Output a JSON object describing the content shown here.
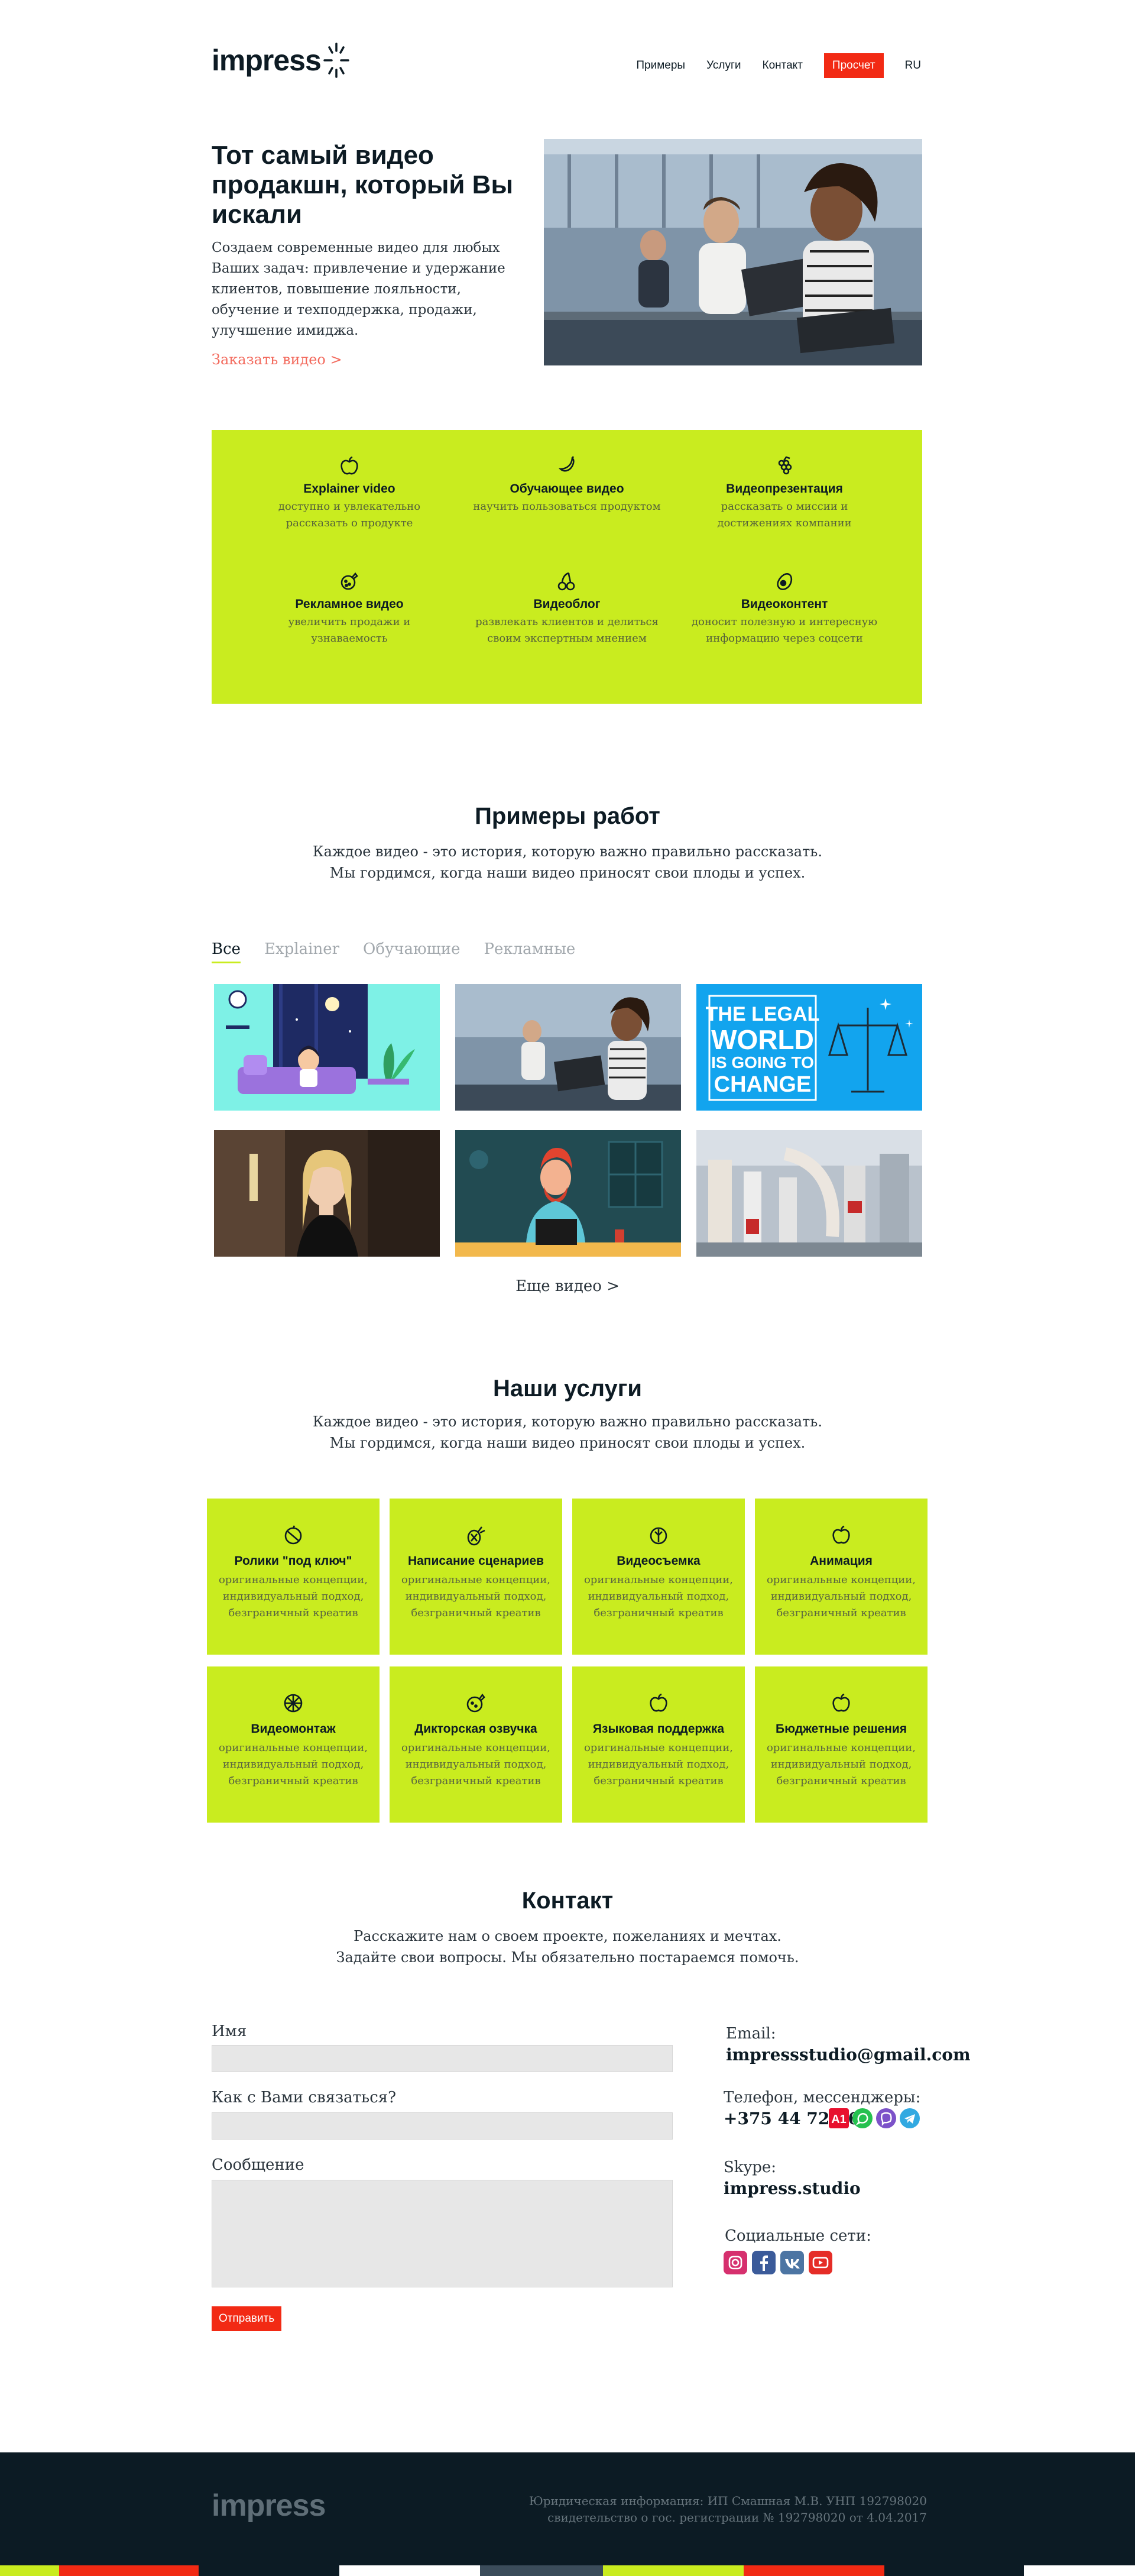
{
  "header": {
    "logo": "impress",
    "nav": [
      "Примеры",
      "Услуги",
      "Контакт"
    ],
    "cta": "Просчет",
    "lang": "RU"
  },
  "hero": {
    "title": "Тот самый видео продакшн, который Вы искали",
    "text": "Создаем современные видео для любых Ваших задач: привлечение и удержание клиентов, повышение лояльности, обучение и техподдержка, продажи, улучшение имиджа.",
    "link": "Заказать видео >"
  },
  "features": [
    {
      "icon": "apple-icon",
      "title": "Explainer video",
      "text": "доступно и увлекательно рассказать о продукте"
    },
    {
      "icon": "banana-icon",
      "title": "Обучающее видео",
      "text": "научить пользоваться продуктом"
    },
    {
      "icon": "grapes-icon",
      "title": "Видеопрезентация",
      "text": "рассказать о миссии и достижениях компании"
    },
    {
      "icon": "pomegranate-icon",
      "title": "Рекламное видео",
      "text": "увеличить продажи и узнаваемость"
    },
    {
      "icon": "cherries-icon",
      "title": "Видеоблог",
      "text": "развлекать клиентов и делиться своим экспертным мнением"
    },
    {
      "icon": "avocado-icon",
      "title": "Видеоконтент",
      "text": "доносит полезную и интересную информацию через соцсети"
    }
  ],
  "works": {
    "title": "Примеры работ",
    "subtitle_1": "Каждое видео - это история, которую важно правильно рассказать.",
    "subtitle_2": "Мы гордимся, когда наши видео приносят свои плоды и успех.",
    "tabs": [
      "Все",
      "Explainer",
      "Обучающие",
      "Рекламные"
    ],
    "thumb_legal_1": "THE LEGAL",
    "thumb_legal_2": "WORLD",
    "thumb_legal_3": "IS GOING TO",
    "thumb_legal_4": "CHANGE",
    "more": "Еще видео >"
  },
  "services": {
    "title": "Наши услуги",
    "subtitle_1": "Каждое видео - это история, которую важно правильно рассказать.",
    "subtitle_2": "Мы гордимся, когда наши видео приносят свои плоды и успех.",
    "items": [
      {
        "icon": "nut-icon",
        "title": "Ролики \"под ключ\"",
        "text": "оригинальные концепции, индивидуальный подход, безграничный креатив"
      },
      {
        "icon": "pineapple-icon",
        "title": "Написание сценариев",
        "text": "оригинальные концепции, индивидуальный подход, безграничный креатив"
      },
      {
        "icon": "lemon-icon",
        "title": "Видеосъемка",
        "text": "оригинальные концепции, индивидуальный подход, безграничный креатив"
      },
      {
        "icon": "apple-icon",
        "title": "Анимация",
        "text": "оригинальные концепции, индивидуальный подход, безграничный креатив"
      },
      {
        "icon": "orange-icon",
        "title": "Видеомонтаж",
        "text": "оригинальные концепции, индивидуальный подход, безграничный креатив"
      },
      {
        "icon": "pomegranate-icon",
        "title": "Дикторская озвучка",
        "text": "оригинальные концепции, индивидуальный подход, безграничный креатив"
      },
      {
        "icon": "apple-icon",
        "title": "Языковая поддержка",
        "text": "оригинальные концепции, индивидуальный подход, безграничный креатив"
      },
      {
        "icon": "apple-icon",
        "title": "Бюджетные решения",
        "text": "оригинальные концепции, индивидуальный подход, безграничный креатив"
      }
    ]
  },
  "contact": {
    "title": "Контакт",
    "subtitle_1": "Расскажите нам о своем проекте, пожеланиях и мечтах.",
    "subtitle_2": "Задайте свои вопросы. Мы обязательно постараемся помочь.",
    "label_name": "Имя",
    "label_contact": "Как с Вами связаться?",
    "label_message": "Сообщение",
    "send": "Отправить",
    "email_label": "Email:",
    "email": "impressstudio@gmail.com",
    "phone_label": "Телефон, мессенджеры:",
    "phone": "+375 44 725-6",
    "skype_label": "Skype:",
    "skype": "impress.studio",
    "social_label": "Социальные сети:"
  },
  "footer": {
    "logo": "impress",
    "info_1": "Юридическая информация: ИП Смашная М.В. УНП 192798020",
    "info_2": "свидетельство о гос. регистрации № 192798020 от 4.04.2017"
  },
  "colors": {
    "accent_green": "#c9ec1f",
    "accent_red": "#f22a14",
    "dark": "#0c1b24"
  }
}
